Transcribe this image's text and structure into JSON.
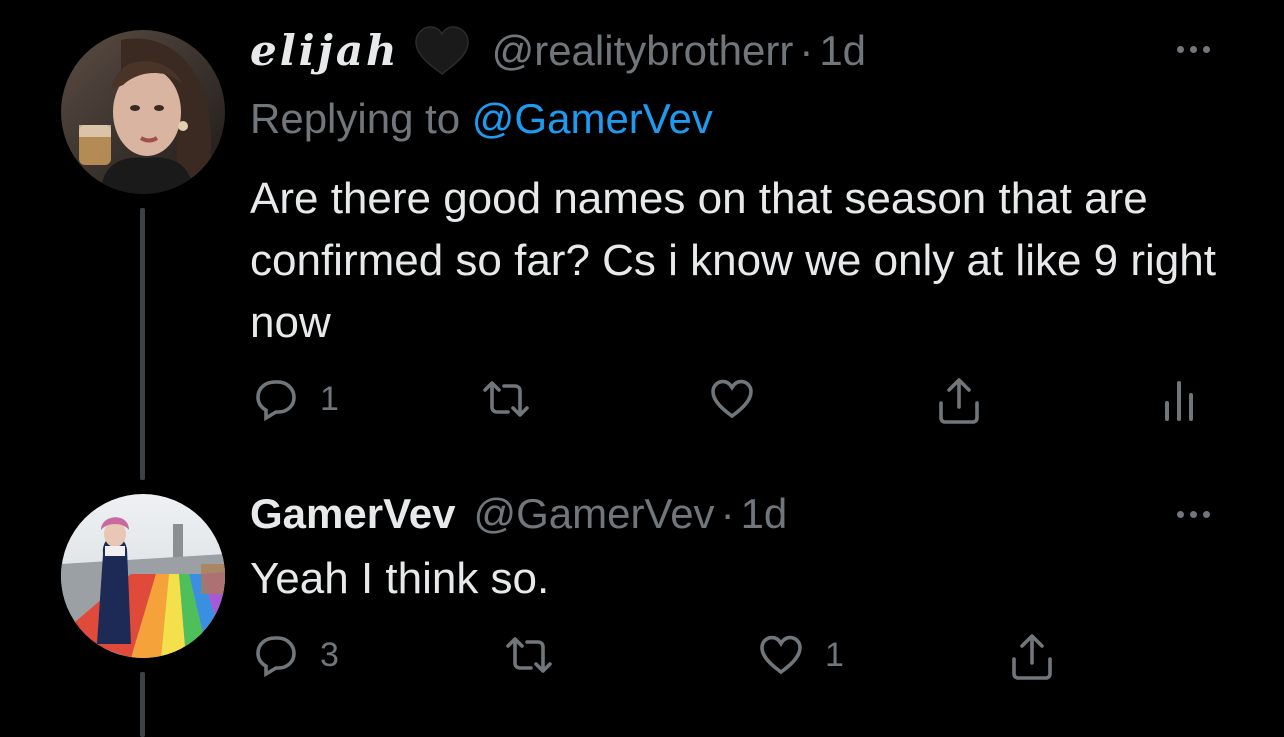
{
  "tweets": [
    {
      "display_name": "elijah",
      "name_badge": "black-heart",
      "handle": "@realitybrotherr",
      "separator": "·",
      "time": "1d",
      "replying_label": "Replying to",
      "replying_to": "@GamerVev",
      "text": "Are there good names on that season that are confirmed so far? Cs i know we only at like 9 right now",
      "actions": {
        "reply_count": "1",
        "retweet_count": "",
        "like_count": ""
      }
    },
    {
      "display_name": "GamerVev",
      "handle": "@GamerVev",
      "separator": "·",
      "time": "1d",
      "text": "Yeah I think so.",
      "actions": {
        "reply_count": "3",
        "retweet_count": "",
        "like_count": "1"
      }
    }
  ],
  "colors": {
    "background": "#000000",
    "text": "#e7e9ea",
    "secondary": "#71767b",
    "link": "#1d9bf0",
    "thread_line": "#3e4144"
  },
  "icons": [
    "reply-icon",
    "retweet-icon",
    "like-icon",
    "share-icon",
    "analytics-icon",
    "more-icon",
    "black-heart-icon"
  ]
}
